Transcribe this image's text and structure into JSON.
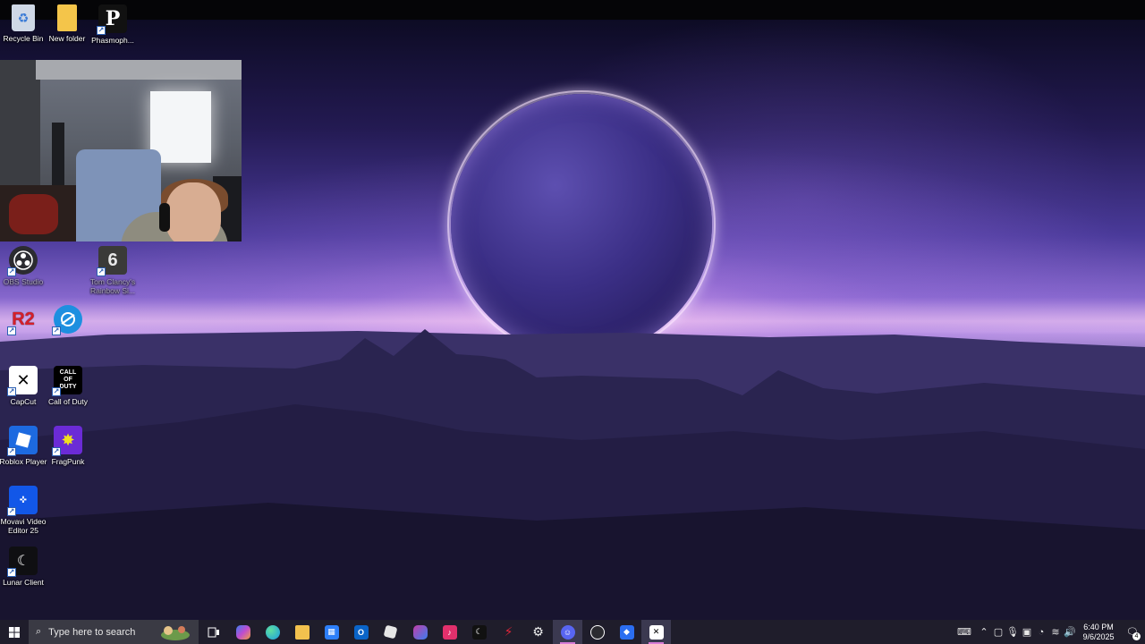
{
  "desktop": {
    "icons": [
      {
        "label": "Recycle Bin",
        "icon": "recycle-bin-icon",
        "color": "#cfd8e6"
      },
      {
        "label": "New folder",
        "icon": "folder-icon",
        "color": "#f4c54a"
      },
      {
        "label": "Phasmoph...",
        "icon": "phasmophobia-icon",
        "color": "#111111"
      },
      {
        "label": "OBS Studio",
        "icon": "obs-icon",
        "color": "#2b2b30"
      },
      {
        "label": "Tom Clancy's Rainbow Si...",
        "icon": "rainbow-six-icon",
        "color": "#3a3a38"
      },
      {
        "label": "",
        "icon": "r2-icon",
        "color": "#c81e28"
      },
      {
        "label": "",
        "icon": "battlenet-icon",
        "color": "#1d8fe0"
      },
      {
        "label": "CapCut",
        "icon": "capcut-icon",
        "color": "#ffffff"
      },
      {
        "label": "Call of Duty",
        "icon": "call-of-duty-icon",
        "color": "#000000"
      },
      {
        "label": "Roblox Player",
        "icon": "roblox-icon",
        "color": "#1d6ae0"
      },
      {
        "label": "FragPunk",
        "icon": "fragpunk-icon",
        "color": "#6b2bd6"
      },
      {
        "label": "Movavi Video Editor 25",
        "icon": "movavi-icon",
        "color": "#1257e8"
      },
      {
        "label": "Lunar Client",
        "icon": "lunar-client-icon",
        "color": "#0f0f12"
      }
    ],
    "glyphs": {
      "r2": "R2",
      "cod": "CALL OF DUTY",
      "r6": "6",
      "phasmo": "P"
    }
  },
  "taskbar": {
    "search_placeholder": "Type here to search",
    "start_icon": "windows-logo-icon",
    "apps": [
      {
        "name": "task-view",
        "icon": "task-view-icon",
        "color": "#2a2a36"
      },
      {
        "name": "copilot",
        "icon": "copilot-icon",
        "color": "#7a5cf0"
      },
      {
        "name": "edge",
        "icon": "edge-icon",
        "color": "#1b9de2"
      },
      {
        "name": "file-explorer",
        "icon": "file-explorer-icon",
        "color": "#f2c14e"
      },
      {
        "name": "microsoft-store",
        "icon": "store-icon",
        "color": "#2d7ff9"
      },
      {
        "name": "outlook",
        "icon": "outlook-icon",
        "color": "#0a64c8"
      },
      {
        "name": "roblox",
        "icon": "roblox-icon",
        "color": "#e6e6e6"
      },
      {
        "name": "m365",
        "icon": "microsoft-365-icon",
        "color": "#c33ea8"
      },
      {
        "name": "tiktok",
        "icon": "tiktok-icon",
        "color": "#e1306c"
      },
      {
        "name": "lunar",
        "icon": "lunar-client-icon",
        "color": "#111111"
      },
      {
        "name": "app-red",
        "icon": "bolt-icon",
        "color": "#e0253a"
      },
      {
        "name": "steelseries",
        "icon": "steelseries-icon",
        "color": "#f0f0f0"
      },
      {
        "name": "discord-ptb",
        "icon": "discord-icon",
        "color": "#5865f2"
      },
      {
        "name": "obs",
        "icon": "obs-icon",
        "color": "#2b2b30"
      },
      {
        "name": "roblox-player",
        "icon": "roblox-player-icon",
        "color": "#2b6ef0"
      },
      {
        "name": "capcut",
        "icon": "capcut-icon",
        "color": "#ffffff"
      }
    ],
    "time": "6:40 PM",
    "date": "9/6/2025",
    "notification_count": "4"
  }
}
